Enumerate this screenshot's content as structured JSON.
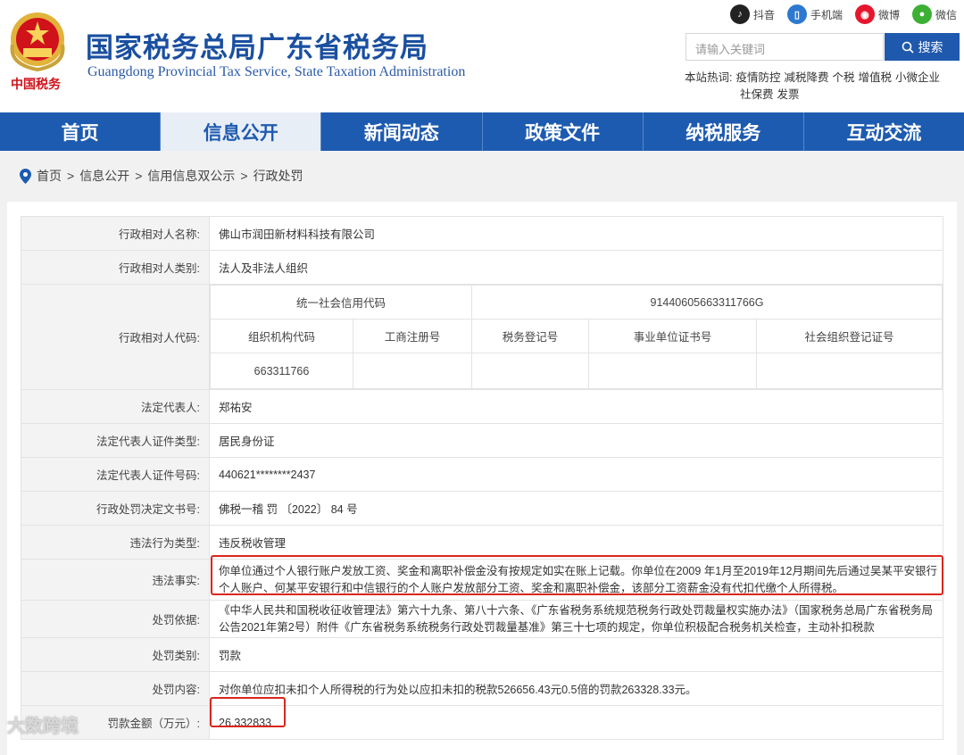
{
  "header": {
    "slogan": "中国税务",
    "title": "国家税务总局广东省税务局",
    "subtitle": "Guangdong Provincial Tax Service, State Taxation Administration",
    "top_links": [
      {
        "label": "抖音",
        "icon": "tiktok-icon",
        "color": "#222222"
      },
      {
        "label": "手机端",
        "icon": "mobile-icon",
        "color": "#2e79d0"
      },
      {
        "label": "微博",
        "icon": "weibo-icon",
        "color": "#e6162d"
      },
      {
        "label": "微信",
        "icon": "wechat-icon",
        "color": "#3cb034"
      }
    ],
    "search_placeholder": "请输入关键词",
    "search_button": "搜索",
    "hot_label": "本站热词:",
    "hot_words": [
      "疫情防控",
      "减税降费",
      "个税",
      "增值税",
      "小微企业",
      "社保费",
      "发票"
    ]
  },
  "nav": {
    "items": [
      "首页",
      "信息公开",
      "新闻动态",
      "政策文件",
      "纳税服务",
      "互动交流"
    ],
    "active_index": 1
  },
  "breadcrumb": [
    "首页",
    "信息公开",
    "信用信息双公示",
    "行政处罚"
  ],
  "record": {
    "name_label": "行政相对人名称:",
    "name": "佛山市润田新材料科技有限公司",
    "type_label": "行政相对人类别:",
    "type": "法人及非法人组织",
    "code_label": "行政相对人代码:",
    "credit_code_label": "统一社会信用代码",
    "credit_code": "914406056633117​66G",
    "sub_headers": [
      "组织机构代码",
      "工商注册号",
      "税务登记号",
      "事业单位证书号",
      "社会组织登记证号"
    ],
    "sub_values": [
      "663311766",
      "",
      "",
      "",
      ""
    ],
    "rep_label": "法定代表人:",
    "rep": "郑祐安",
    "id_type_label": "法定代表人证件类型:",
    "id_type": "居民身份证",
    "id_no_label": "法定代表人证件号码:",
    "id_no": "440621********2437",
    "doc_label": "行政处罚决定文书号:",
    "doc": "佛税一稽 罚 〔2022〕 84 号",
    "vio_type_label": "违法行为类型:",
    "vio_type": "违反税收管理",
    "facts_label": "违法事实:",
    "facts": "你单位通过个人银行账户发放工资、奖金和离职补偿金没有按规定如实在账上记载。你单位在2009 年1月至2019年12月期间先后通过吴某平安银行个人账户、何某平安银行和中信银行的个人账户发放部分工资、奖金和离职补偿金，该部分工资薪金没有代扣代缴个人所得税。",
    "basis_label": "处罚依据:",
    "basis": "《中华人民共和国税收征收管理法》第六十九条、第八十六条、《广东省税务系统规范税务行政处罚裁量权实施办法》（国家税务总局广东省税务局公告2021年第2号）附件《广东省税务系统税务行政处罚裁量基准》第三十七项的规定，你单位积极配合税务机关检查，主动补扣税款",
    "category_label": "处罚类别:",
    "category": "罚款",
    "content_label": "处罚内容:",
    "content": "对你单位应扣未扣个人所得税的行为处以应扣未扣的税款526656.43元0.5倍的罚款263328.33元。",
    "amount_label": "罚款金额（万元）:",
    "amount": "26.332833"
  },
  "watermark": "大数跨境"
}
